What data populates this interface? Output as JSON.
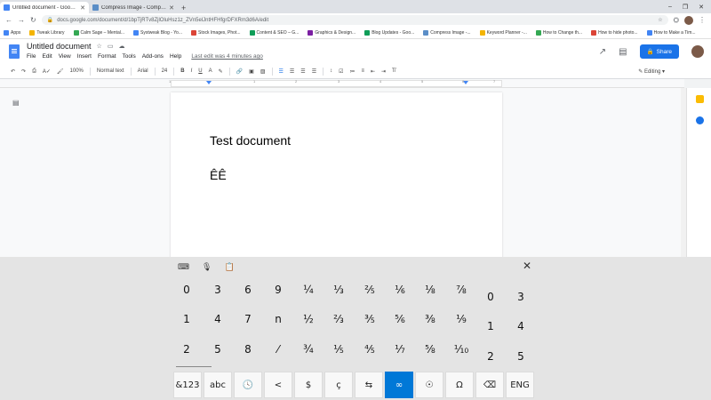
{
  "browser": {
    "tabs": [
      {
        "title": "Untitled document - Google Do",
        "active": true,
        "color": "#4285f4"
      },
      {
        "title": "Compress Image - Compression",
        "active": false,
        "color": "#5b8ec7"
      }
    ],
    "new_tab": "+",
    "url": "docs.google.com/document/d/1bpTjRTv8ZjlOluHsz1z_ZVn5elJntHFHfgrDFXRm3d6A/edit",
    "bookmarks": [
      {
        "label": "Apps",
        "color": "#4285f4"
      },
      {
        "label": "Tweak Library",
        "color": "#f4b400"
      },
      {
        "label": "Calm Sage – Mental...",
        "color": "#34a853"
      },
      {
        "label": "Systweak Blog - Yo...",
        "color": "#4285f4"
      },
      {
        "label": "Stock Images, Phot...",
        "color": "#db4437"
      },
      {
        "label": "Content & SEO – G...",
        "color": "#0f9d58"
      },
      {
        "label": "Graphics & Design...",
        "color": "#7b1fa2"
      },
      {
        "label": "Blog Updates - Goo...",
        "color": "#0f9d58"
      },
      {
        "label": "Compress Image -...",
        "color": "#5b8ec7"
      },
      {
        "label": "Keyword Planner -...",
        "color": "#f4b400"
      },
      {
        "label": "How to Change th...",
        "color": "#34a853"
      },
      {
        "label": "How to hide photo...",
        "color": "#db4437"
      },
      {
        "label": "How to Make a Tim...",
        "color": "#4285f4"
      }
    ]
  },
  "docs": {
    "title": "Untitled document",
    "menu": [
      "File",
      "Edit",
      "View",
      "Insert",
      "Format",
      "Tools",
      "Add-ons",
      "Help"
    ],
    "last_edit": "Last edit was 4 minutes ago",
    "share_label": "Share",
    "toolbar": {
      "zoom": "100%",
      "style": "Normal text",
      "font": "Arial",
      "size": "24",
      "mode": "Editing"
    },
    "ruler_marks": [
      "1",
      "1",
      "2",
      "3",
      "4",
      "5",
      "6",
      "7"
    ],
    "body_lines": [
      "Test document",
      "ÊÊ"
    ]
  },
  "keyboard": {
    "columns": [
      [
        "0",
        "1",
        "2"
      ],
      [
        "3",
        "4",
        "5"
      ],
      [
        "6",
        "7",
        "8"
      ],
      [
        "9",
        "n",
        "⁄"
      ],
      [
        "¼",
        "½",
        "¾"
      ],
      [
        "⅓",
        "⅔",
        "⅕"
      ],
      [
        "⅖",
        "⅗",
        "⅘"
      ],
      [
        "⅙",
        "⅚",
        "⅐"
      ],
      [
        "⅛",
        "⅜",
        "⅝"
      ],
      [
        "⅞",
        "⅑",
        "⅒"
      ],
      [
        "0",
        "1",
        "2"
      ],
      [
        "3",
        "4",
        "5"
      ]
    ],
    "bottom_row": [
      "&123",
      "abc",
      "🕓",
      "<",
      "$",
      "ç",
      "⇆",
      "∞",
      "☉",
      "Ω",
      "⌫",
      "ENG"
    ],
    "selected_bottom": 7,
    "top_icons": [
      "keyboard-settings-icon",
      "microphone-icon",
      "clipboard-icon"
    ],
    "close": "✕"
  }
}
